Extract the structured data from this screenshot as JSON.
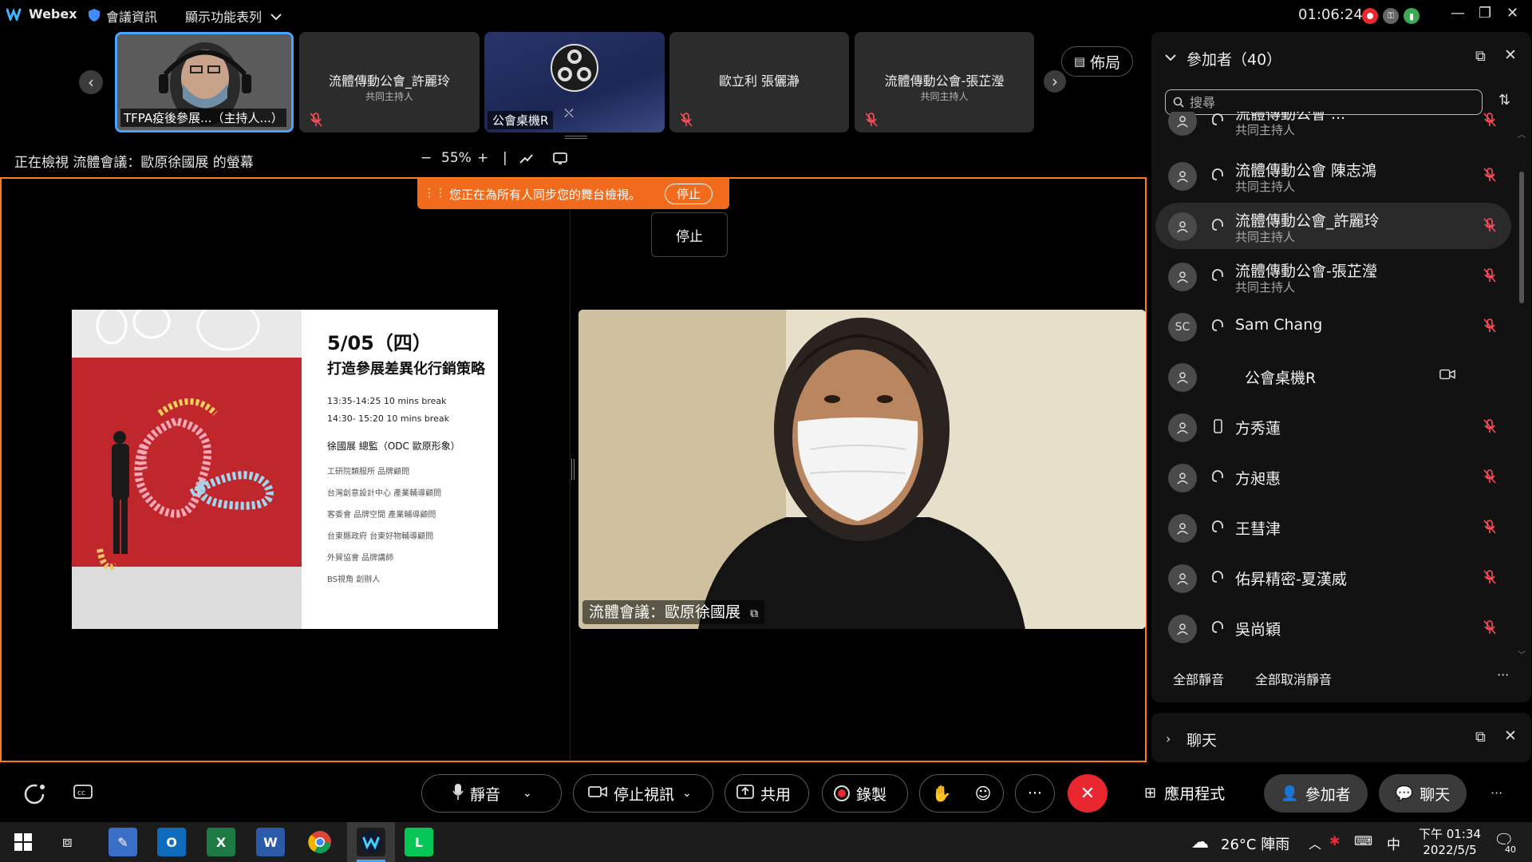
{
  "app": {
    "name": "Webex",
    "meeting_info_label": "會議資訊",
    "show_menu_label": "顯示功能表列",
    "clock": "01:06:24"
  },
  "thumbnails": [
    {
      "name": "TFPA疫後參展...（主持人...）",
      "role": "",
      "muted": false
    },
    {
      "name": "流體傳動公會_許麗玲",
      "role": "共同主持人",
      "muted": true
    },
    {
      "name": "公會桌機R",
      "role": "",
      "muted": false
    },
    {
      "name": "歐立利 張儷瀞",
      "role": "",
      "muted": true
    },
    {
      "name": "流體傳動公會-張芷瀅",
      "role": "共同主持人",
      "muted": true
    }
  ],
  "layout_button": "佈局",
  "viewing": {
    "text": "正在檢視 流體會議：歐原徐國展 的螢幕",
    "zoom_minus": "−",
    "zoom_value": "55%",
    "zoom_plus": "+",
    "separator": "|"
  },
  "sync_banner": {
    "text": "您正在為所有人同步您的舞台檢視。",
    "stop_label": "停止",
    "tooltip": "停止"
  },
  "slide": {
    "date": "5/05（四）",
    "title": "打造參展差異化行銷策略",
    "time1": "13:35-14:25 10 mins break",
    "time2": "14:30- 15:20 10 mins break",
    "speaker": "徐國展 總監（ODC 歐原形象）",
    "bio": [
      "工研院類服所 品牌顧問",
      "台灣創意設計中心 產業輔導顧問",
      "客委會 品牌空間 產業輔導顧問",
      "台東縣政府 台東好物輔導顧問",
      "外貿協會 品牌講師",
      "BS視角 創辦人"
    ]
  },
  "camera": {
    "label": "流體會議：歐原徐國展"
  },
  "panel": {
    "title": "參加者（40）",
    "search_placeholder": "搜尋",
    "participants": [
      {
        "name": "流體傳動公會 ...",
        "role": "共同主持人",
        "avatar": "",
        "device": "headset",
        "muted": true,
        "partial": true
      },
      {
        "name": "流體傳動公會 陳志鴻",
        "role": "共同主持人",
        "avatar": "",
        "device": "headset",
        "muted": true
      },
      {
        "name": "流體傳動公會_許麗玲",
        "role": "共同主持人",
        "avatar": "",
        "device": "headset",
        "muted": true,
        "highlight": true
      },
      {
        "name": "流體傳動公會-張芷瀅",
        "role": "共同主持人",
        "avatar": "",
        "device": "headset",
        "muted": true
      },
      {
        "name": "Sam Chang",
        "role": "",
        "avatar": "SC",
        "device": "headset",
        "muted": true
      },
      {
        "name": "公會桌機R",
        "role": "",
        "avatar": "",
        "device": "none",
        "muted": false
      },
      {
        "name": "方秀蓮",
        "role": "",
        "avatar": "",
        "device": "phone",
        "muted": true
      },
      {
        "name": "方昶惠",
        "role": "",
        "avatar": "",
        "device": "headset",
        "muted": true
      },
      {
        "name": "王彗津",
        "role": "",
        "avatar": "",
        "device": "headset",
        "muted": true
      },
      {
        "name": "佑昇精密-夏漢威",
        "role": "",
        "avatar": "",
        "device": "headset",
        "muted": true
      },
      {
        "name": "吳尚穎",
        "role": "",
        "avatar": "",
        "device": "headset",
        "muted": true
      }
    ],
    "mute_all": "全部靜音",
    "unmute_all": "全部取消靜音",
    "more": "···",
    "chat_title": "聊天"
  },
  "controls": {
    "mute": "靜音",
    "stop_video": "停止視訊",
    "share": "共用",
    "record": "錄製",
    "more": "···",
    "apps": "應用程式",
    "participants": "參加者",
    "chat": "聊天"
  },
  "taskbar": {
    "weather": "26°C 陣雨",
    "ime": "中",
    "time": "下午 01:34",
    "date": "2022/5/5",
    "notif_count": "40"
  },
  "colors": {
    "accent_orange": "#f26b1d",
    "end_call_red": "#e8272f",
    "record_red": "#e8272f"
  }
}
